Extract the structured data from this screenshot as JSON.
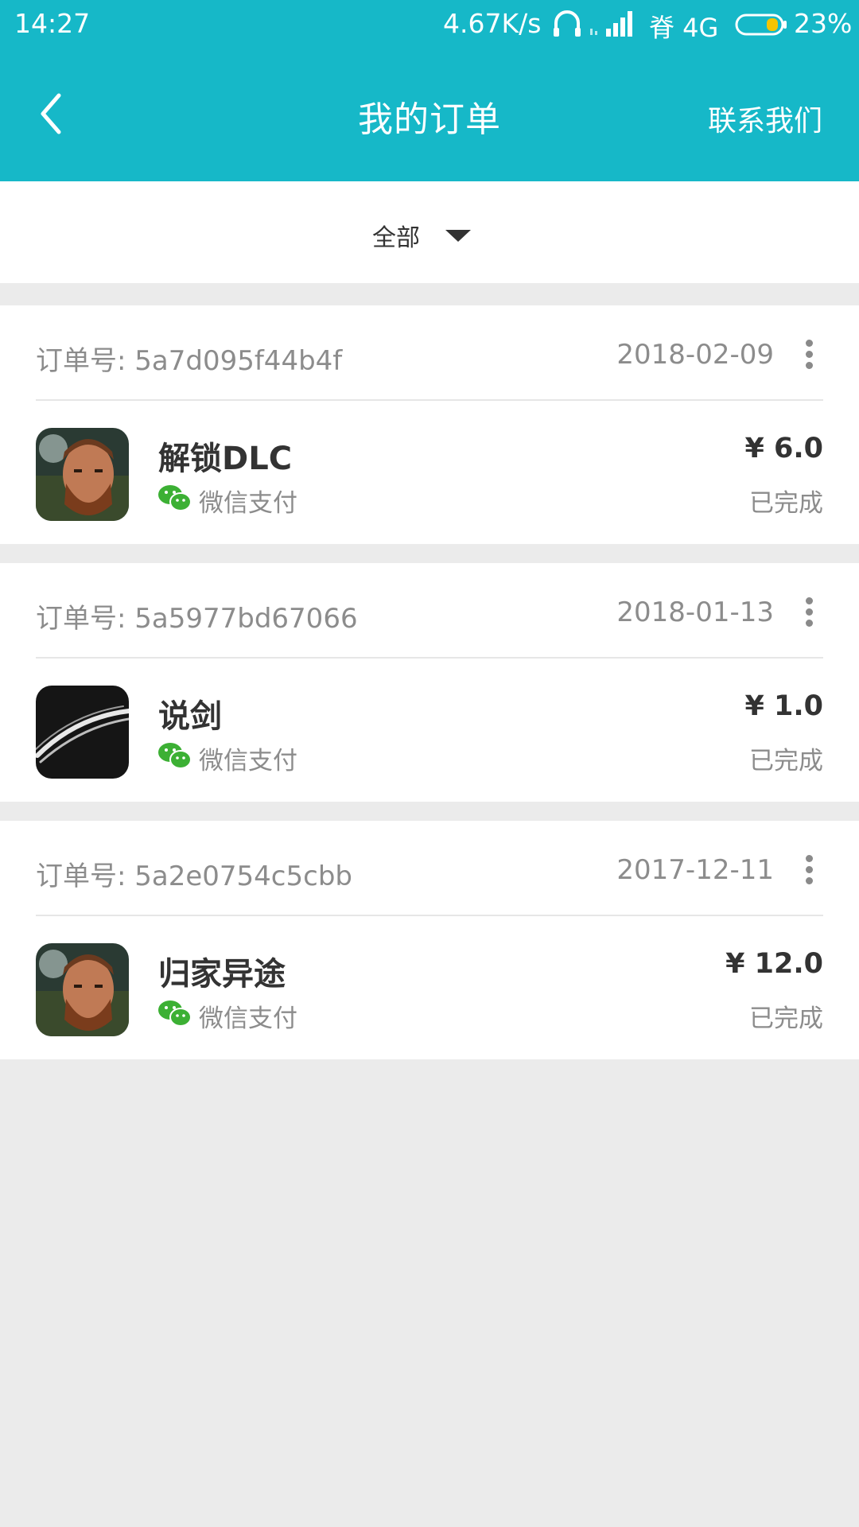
{
  "status_bar": {
    "time": "14:27",
    "net_speed": "4.67K/s",
    "carrier": "脊 4G",
    "battery": "23%"
  },
  "header": {
    "title": "我的订单",
    "contact_label": "联系我们",
    "bg_color": "#16b8c8"
  },
  "filter": {
    "selected": "全部"
  },
  "orders": [
    {
      "order_no": "订单号: 5a7d095f44b4f",
      "date": "2018-02-09",
      "name": "解锁DLC",
      "pay_method": "微信支付",
      "price": "¥ 6.0",
      "status": "已完成",
      "icon": "bearded-man-game-icon"
    },
    {
      "order_no": "订单号: 5a5977bd67066",
      "date": "2018-01-13",
      "name": "说剑",
      "pay_method": "微信支付",
      "price": "¥ 1.0",
      "status": "已完成",
      "icon": "sword-slash-game-icon"
    },
    {
      "order_no": "订单号: 5a2e0754c5cbb",
      "date": "2017-12-11",
      "name": "归家异途",
      "pay_method": "微信支付",
      "price": "¥ 12.0",
      "status": "已完成",
      "icon": "bearded-man-game-icon"
    }
  ]
}
